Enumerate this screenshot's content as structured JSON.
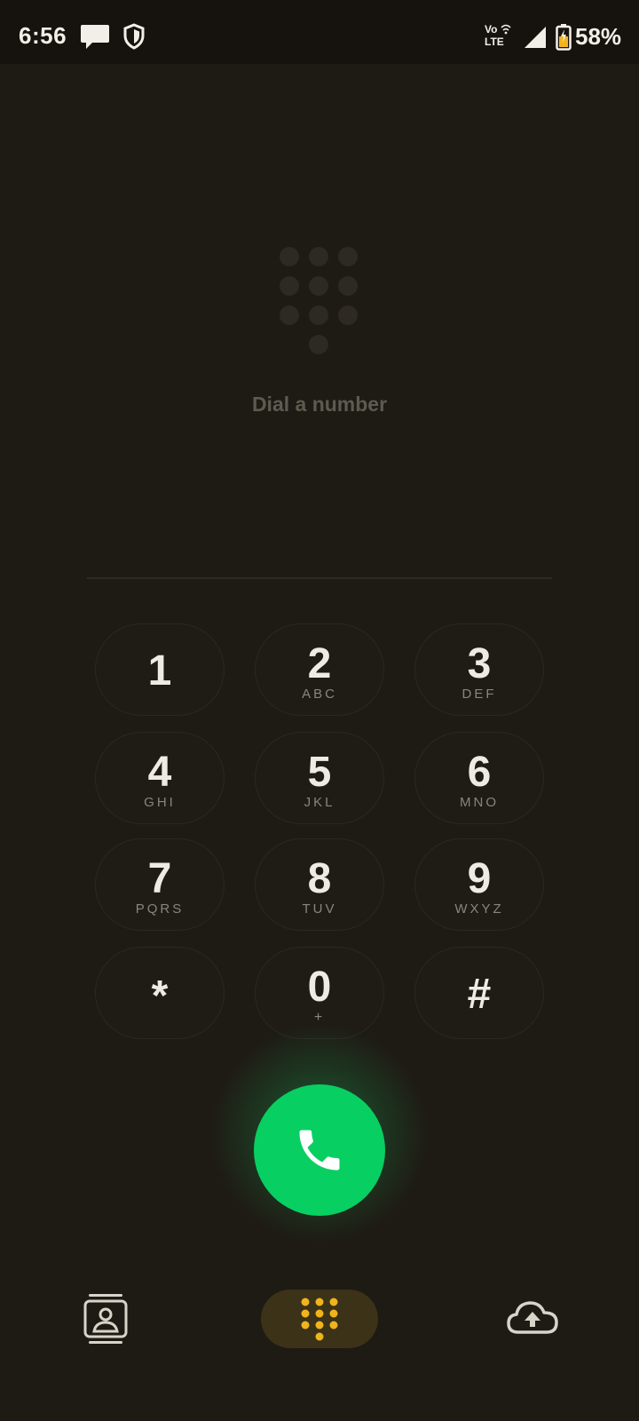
{
  "status_bar": {
    "time": "6:56",
    "volte_top": "Vo",
    "volte_bottom": "LTE",
    "battery_percent": "58%",
    "icons": [
      "message-icon",
      "shield-icon",
      "volte-icon",
      "signal-icon",
      "battery-icon"
    ]
  },
  "empty_state": {
    "text": "Dial a number"
  },
  "keypad": {
    "keys": [
      {
        "digit": "1",
        "letters": ""
      },
      {
        "digit": "2",
        "letters": "ABC"
      },
      {
        "digit": "3",
        "letters": "DEF"
      },
      {
        "digit": "4",
        "letters": "GHI"
      },
      {
        "digit": "5",
        "letters": "JKL"
      },
      {
        "digit": "6",
        "letters": "MNO"
      },
      {
        "digit": "7",
        "letters": "PQRS"
      },
      {
        "digit": "8",
        "letters": "TUV"
      },
      {
        "digit": "9",
        "letters": "WXYZ"
      },
      {
        "digit": "*",
        "letters": ""
      },
      {
        "digit": "0",
        "letters": "+"
      },
      {
        "digit": "#",
        "letters": ""
      }
    ]
  },
  "call_button": {
    "icon": "phone-icon",
    "color": "#08cf62"
  },
  "bottom_nav": {
    "items": [
      {
        "icon": "contacts-icon",
        "active": false
      },
      {
        "icon": "dialpad-icon",
        "active": true
      },
      {
        "icon": "cloud-upload-icon",
        "active": false
      }
    ],
    "accent": "#f0b41c"
  }
}
